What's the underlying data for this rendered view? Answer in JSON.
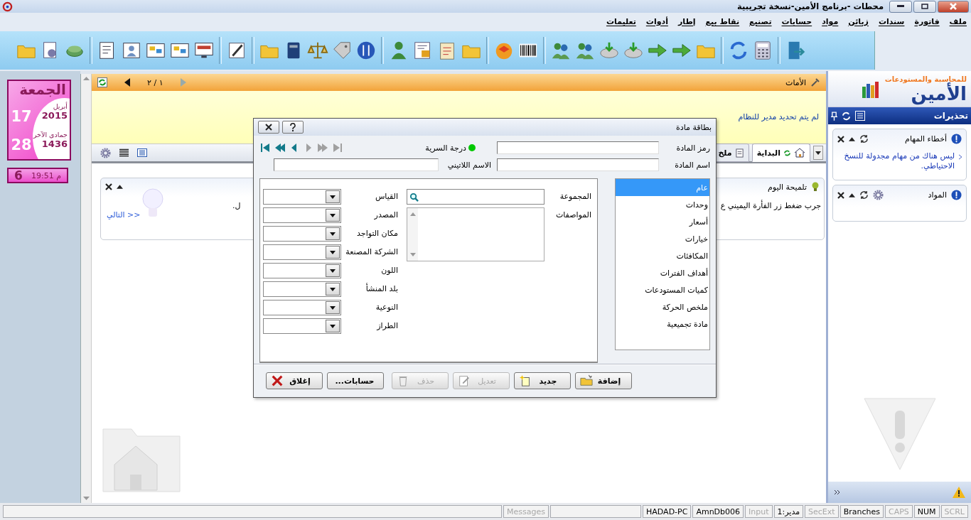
{
  "window": {
    "title": "محطات -برنامج الأمين-نسخة تجريبية"
  },
  "menu": [
    "ملف",
    "فاتورة",
    "سندات",
    "زبائن",
    "مواد",
    "حسابات",
    "تصنيع",
    "نقاط بيع",
    "إطار",
    "أدوات",
    "تعليمات"
  ],
  "calendar": {
    "weekday": "الجمعة",
    "greg_day": "17",
    "greg_month": "أبريل",
    "greg_year": "2015",
    "hijri_day": "28",
    "hijri_month": "جمادى الآخر",
    "hijri_year": "1436",
    "time": "م 19:51",
    "week": "6"
  },
  "home": {
    "panel_title": "الأمات",
    "pager": "١ / ٢",
    "notice": "لم يتم تحديد مدير للنظام",
    "tabs": [
      {
        "label": "البداية",
        "selected": true
      },
      {
        "label": "ملخ",
        "selected": false
      }
    ],
    "tip": {
      "title": "تلميحة اليوم",
      "text": "جرب ضغط زر الفأرة اليميني ع",
      "text_tail": "ل.",
      "next_link": "التالي >>"
    }
  },
  "dialog": {
    "title": "بطاقة مادة",
    "code_label": "رمز المادة",
    "name_label": "اسم المادة",
    "latin_label": "الاسم اللاتيني",
    "secrecy": {
      "label": "درجة السرية",
      "color": "#00c800"
    },
    "nav": [
      {
        "kind": "first",
        "disabled": false
      },
      {
        "kind": "prev-page",
        "disabled": false
      },
      {
        "kind": "prev",
        "disabled": false
      },
      {
        "kind": "next",
        "disabled": true
      },
      {
        "kind": "next-page",
        "disabled": true
      },
      {
        "kind": "last",
        "disabled": true
      }
    ],
    "sections": [
      {
        "label": "عام",
        "selected": true
      },
      {
        "label": "وحدات",
        "selected": false
      },
      {
        "label": "أسعار",
        "selected": false
      },
      {
        "label": "خيارات",
        "selected": false
      },
      {
        "label": "المكافئات",
        "selected": false
      },
      {
        "label": "أهداف الفترات",
        "selected": false
      },
      {
        "label": "كميات المستودعات",
        "selected": false
      },
      {
        "label": "ملخص الحركة",
        "selected": false
      },
      {
        "label": "مادة تجميعية",
        "selected": false
      }
    ],
    "group_label": "المجموعة",
    "specs_label": "المواصفات",
    "dropdowns": [
      "القياس",
      "المصدر",
      "مكان التواجد",
      "الشركة المصنعة",
      "اللون",
      "بلد المنشأ",
      "النوعية",
      "الطراز"
    ],
    "buttons": [
      {
        "kind": "add",
        "label": "إضافة",
        "disabled": false
      },
      {
        "kind": "new",
        "label": "جديد",
        "disabled": false
      },
      {
        "kind": "edit",
        "label": "تعديل",
        "disabled": true
      },
      {
        "kind": "delete",
        "label": "حذف",
        "disabled": true
      },
      {
        "kind": "accounts",
        "label": "حسابات...",
        "disabled": false
      },
      {
        "kind": "close",
        "label": "إغلاق",
        "disabled": false
      }
    ]
  },
  "alerts": {
    "logo": {
      "name": "الأمين",
      "tagline": "للمحاسبة والمستودعات"
    },
    "title": "تحذيرات",
    "cards": [
      {
        "title": "أخطاء المهام",
        "message": "ليس هناك من مهام مجدولة للنسخ الاحتياطي.",
        "settings": false
      },
      {
        "title": "المواد",
        "settings": true
      }
    ]
  },
  "status_bar": [
    {
      "text": "SCRL",
      "disabled": true
    },
    {
      "text": "NUM",
      "disabled": false
    },
    {
      "text": "CAPS",
      "disabled": true
    },
    {
      "text": "Branches",
      "disabled": false
    },
    {
      "text": "SecExt",
      "disabled": true
    },
    {
      "text": "مدير:1",
      "disabled": false
    },
    {
      "text": "Input",
      "disabled": true
    },
    {
      "text": "AmnDb006",
      "disabled": false
    },
    {
      "text": "HADAD-PC",
      "disabled": false
    },
    {
      "text": "Messages",
      "disabled": true
    }
  ]
}
